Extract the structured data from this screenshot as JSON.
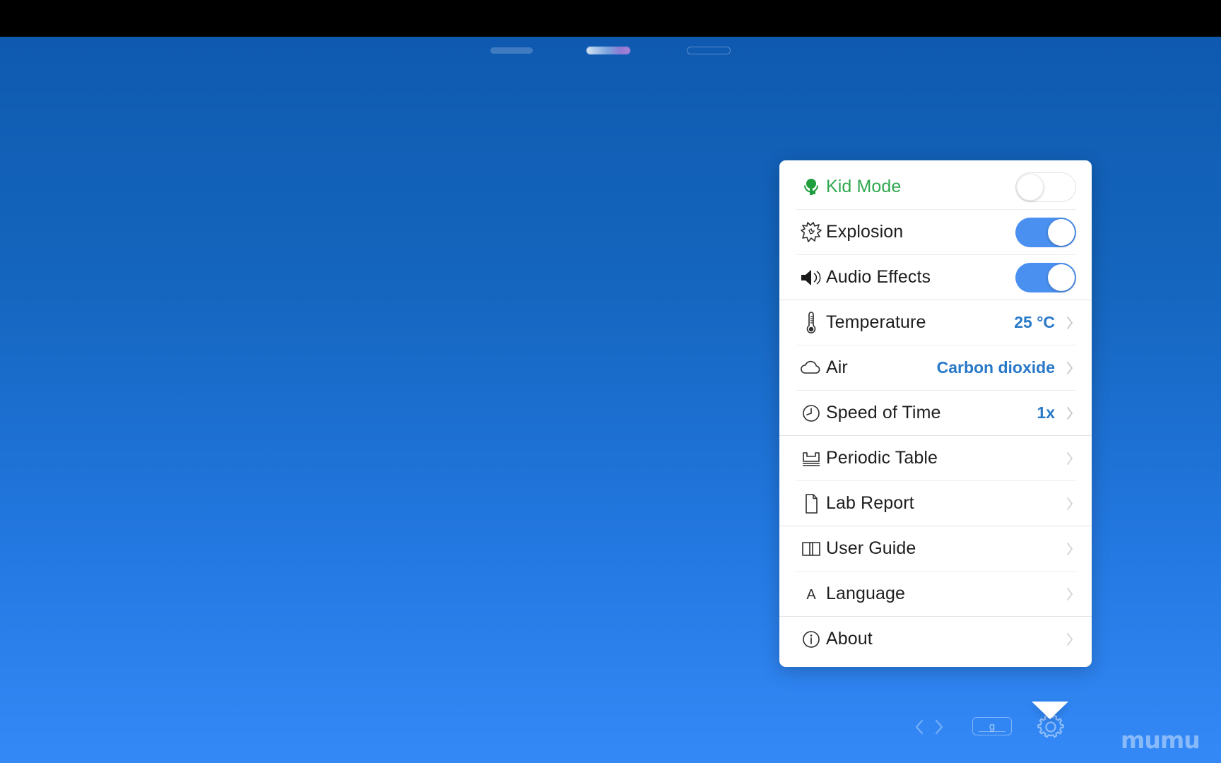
{
  "window": {
    "background_top_color": "#0f5ab0",
    "background_bottom_color": "#3489f7",
    "watermark": "mumu"
  },
  "top_toolbar": {
    "items": [
      {
        "name": "tool-pill-left",
        "style": "solid"
      },
      {
        "name": "tool-pill-gradient",
        "style": "gradient"
      },
      {
        "name": "tool-pill-outline",
        "style": "outline"
      }
    ]
  },
  "bottom_toolbar": {
    "back_label": "",
    "forward_label": "",
    "unit_chip_label": "g",
    "settings_label": ""
  },
  "settings_panel": {
    "accent_color": "#4a90f0",
    "value_color": "#2878c8",
    "kid_mode_color": "#2fa84f",
    "groups": [
      {
        "name": "toggles",
        "items": [
          {
            "id": "kid-mode",
            "label": "Kid Mode",
            "icon": "child-icon",
            "control": "toggle",
            "state": "off"
          },
          {
            "id": "explosion",
            "label": "Explosion",
            "icon": "explosion-icon",
            "control": "toggle",
            "state": "on"
          },
          {
            "id": "audio-effects",
            "label": "Audio Effects",
            "icon": "speaker-icon",
            "control": "toggle",
            "state": "on"
          }
        ]
      },
      {
        "name": "environment",
        "items": [
          {
            "id": "temperature",
            "label": "Temperature",
            "icon": "thermometer-icon",
            "control": "value",
            "value": "25",
            "unit": "°C"
          },
          {
            "id": "air",
            "label": "Air",
            "icon": "cloud-icon",
            "control": "value",
            "value": "Carbon dioxide",
            "unit": ""
          },
          {
            "id": "speed-of-time",
            "label": "Speed of Time",
            "icon": "clock-icon",
            "control": "value",
            "value": "1x",
            "unit": ""
          }
        ]
      },
      {
        "name": "tools",
        "items": [
          {
            "id": "periodic-table",
            "label": "Periodic Table",
            "icon": "periodic-table-icon",
            "control": "link",
            "value": ""
          },
          {
            "id": "lab-report",
            "label": "Lab Report",
            "icon": "document-icon",
            "control": "link",
            "value": ""
          }
        ]
      },
      {
        "name": "help",
        "items": [
          {
            "id": "user-guide",
            "label": "User Guide",
            "icon": "book-icon",
            "control": "link",
            "value": ""
          },
          {
            "id": "language",
            "label": "Language",
            "icon": "letter-a-icon",
            "control": "link",
            "value": ""
          },
          {
            "id": "about",
            "label": "About",
            "icon": "info-icon",
            "control": "link",
            "value": ""
          }
        ]
      }
    ]
  }
}
